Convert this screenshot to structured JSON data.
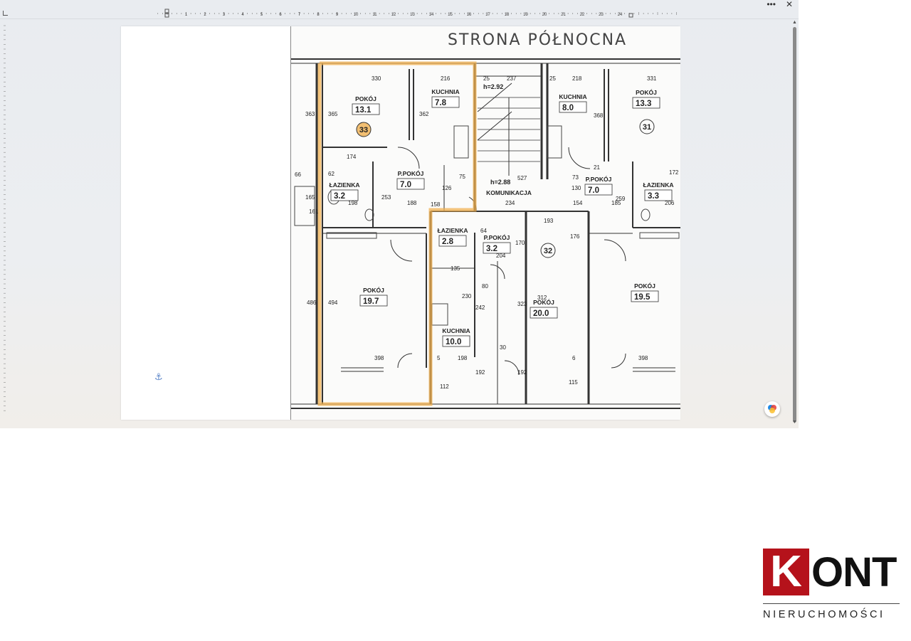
{
  "window": {
    "controls": {
      "more": "•••",
      "close": "✕"
    }
  },
  "ruler": {
    "numbers": [
      "1",
      "2",
      "3",
      "4",
      "5",
      "6",
      "7",
      "8",
      "9",
      "10",
      "11",
      "12",
      "13",
      "14",
      "15",
      "16",
      "17",
      "18",
      "19",
      "20",
      "21",
      "22",
      "23",
      "24"
    ]
  },
  "plan": {
    "heading": "STRONA PÓŁNOCNA",
    "heights": {
      "top": "h=2.92",
      "mid": "h=2.88"
    },
    "unit_numbers": [
      "33",
      "31",
      "32"
    ],
    "rooms": [
      {
        "name": "POKÓJ",
        "area": "13.1"
      },
      {
        "name": "KUCHNIA",
        "area": "7.8"
      },
      {
        "name": "ŁAZIENKA",
        "area": "3.2"
      },
      {
        "name": "P.POKÓJ",
        "area": "7.0"
      },
      {
        "name": "POKÓJ",
        "area": "19.7"
      },
      {
        "name": "KOMUNIKACJA",
        "area": ""
      },
      {
        "name": "KUCHNIA",
        "area": "8.0"
      },
      {
        "name": "POKÓJ",
        "area": "13.3"
      },
      {
        "name": "P.POKÓJ",
        "area": "7.0"
      },
      {
        "name": "ŁAZIENKA",
        "area": "3.3"
      },
      {
        "name": "ŁAZIENKA",
        "area": "2.8"
      },
      {
        "name": "P.POKÓJ",
        "area": "3.2"
      },
      {
        "name": "KUCHNIA",
        "area": "10.0"
      },
      {
        "name": "POKÓJ",
        "area": "20.0"
      },
      {
        "name": "POKÓJ",
        "area": "19.5"
      }
    ],
    "dimensions": [
      "330",
      "216",
      "25",
      "237",
      "25",
      "218",
      "331",
      "363",
      "365",
      "362",
      "368",
      "174",
      "172",
      "66",
      "165",
      "161",
      "62",
      "253",
      "198",
      "188",
      "158",
      "126",
      "75",
      "527",
      "130",
      "73",
      "259",
      "185",
      "206",
      "154",
      "234",
      "21",
      "193",
      "176",
      "170",
      "64",
      "204",
      "135",
      "230",
      "242",
      "323",
      "312",
      "486",
      "494",
      "398",
      "398",
      "198",
      "30",
      "192",
      "192",
      "115",
      "112",
      "6",
      "5",
      "80"
    ]
  },
  "logo": {
    "letter": "K",
    "rest": "ONT",
    "tagline": "NIERUCHOMOŚCI",
    "colors": {
      "red": "#b5121b",
      "dark": "#111111"
    }
  },
  "colors": {
    "highlight": "#f0b050",
    "app_background": "#eaedf1"
  },
  "icons": {
    "anchor": "⚓",
    "copilot": "copilot-icon"
  }
}
